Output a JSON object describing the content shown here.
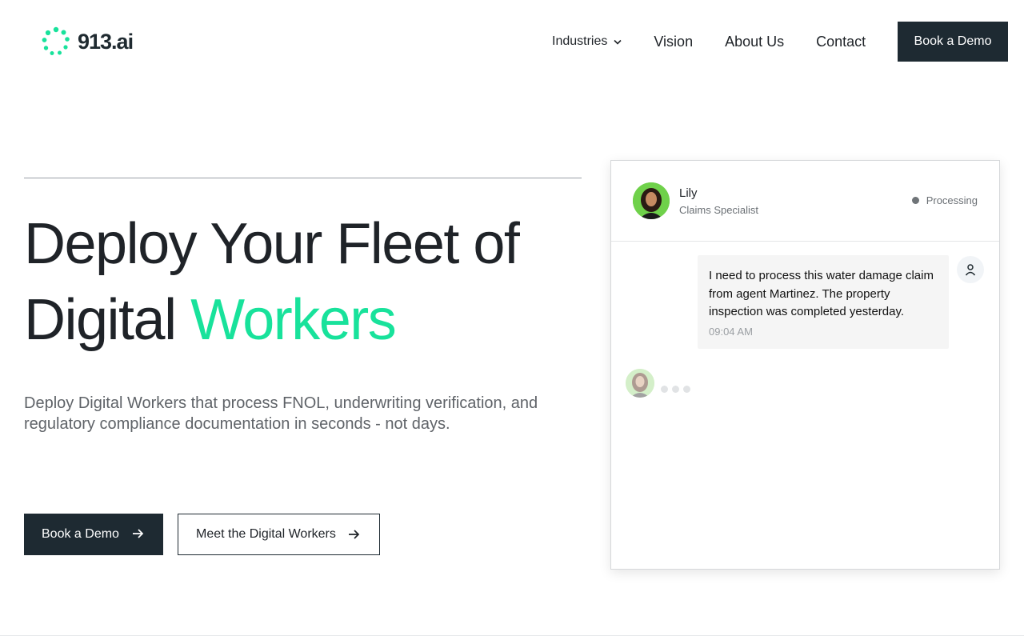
{
  "header": {
    "logo_text": "913.ai",
    "logo_color": "#18e29b",
    "nav": {
      "industries": "Industries",
      "vision": "Vision",
      "about": "About Us",
      "contact": "Contact"
    },
    "cta": "Book a Demo"
  },
  "hero": {
    "title_part1": "Deploy Your Fleet of",
    "title_part2": "Digital ",
    "title_accent": "Workers",
    "accent_color": "#18e29b",
    "subtitle": "Deploy Digital Workers that process FNOL, underwriting verification, and regulatory compliance documentation in seconds - not days.",
    "primary_button": "Book a Demo",
    "secondary_button": "Meet the Digital Workers"
  },
  "chat": {
    "agent_name": "Lily",
    "agent_role": "Claims Specialist",
    "status": "Processing",
    "message_text": "I need to process this water damage claim from agent Martinez. The property inspection was completed yesterday.",
    "message_time": "09:04 AM"
  }
}
